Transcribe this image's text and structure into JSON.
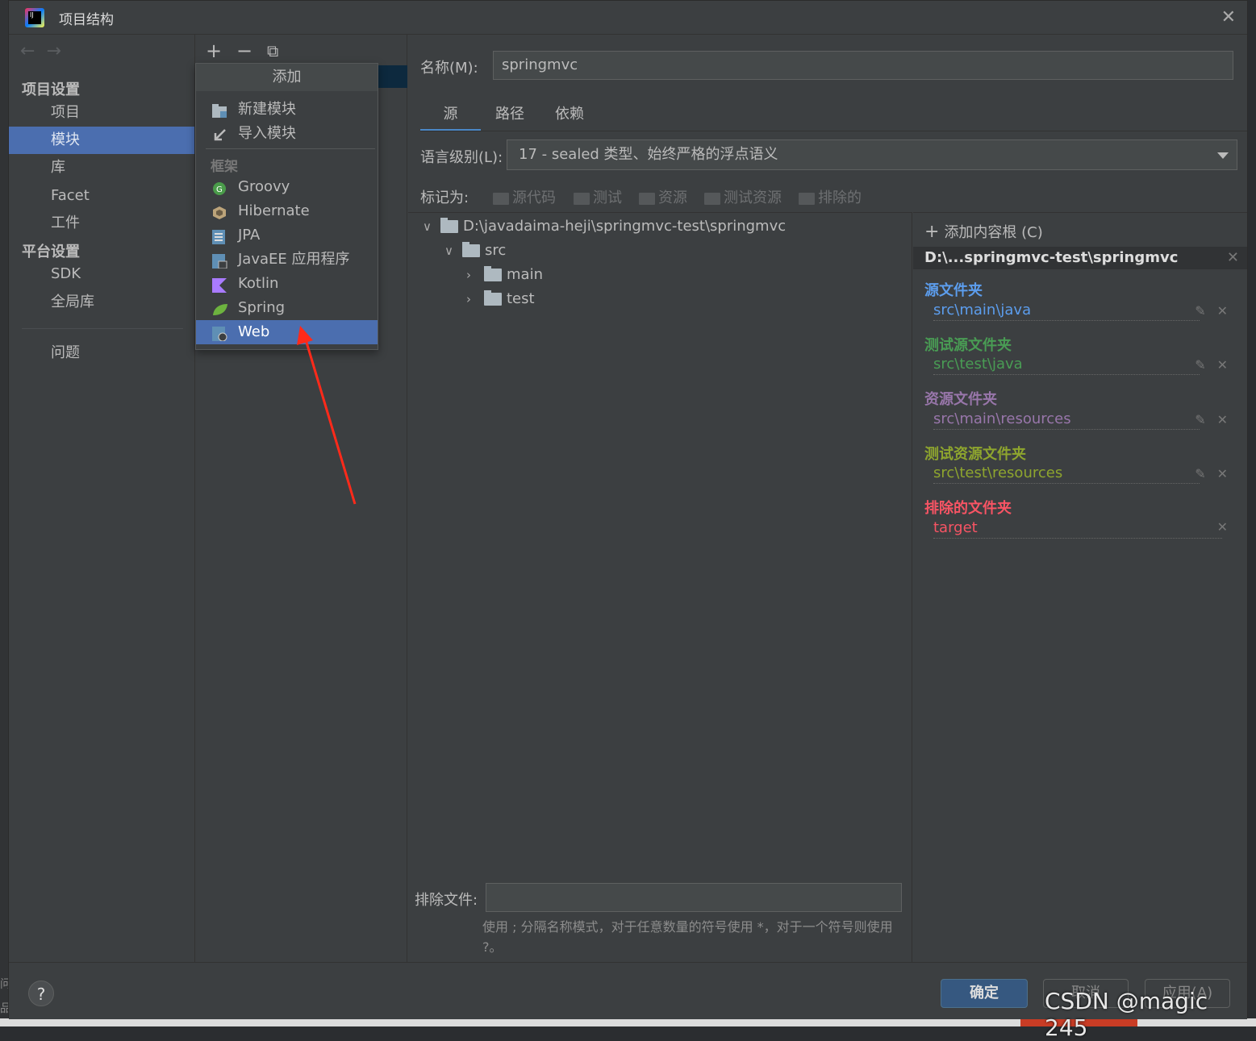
{
  "window": {
    "title": "项目结构"
  },
  "sidebar": {
    "project_settings_header": "项目设置",
    "platform_settings_header": "平台设置",
    "items": [
      {
        "label": "项目"
      },
      {
        "label": "模块"
      },
      {
        "label": "库"
      },
      {
        "label": "Facet"
      },
      {
        "label": "工件"
      },
      {
        "label": "SDK"
      },
      {
        "label": "全局库"
      },
      {
        "label": "问题"
      }
    ]
  },
  "module_toolbar": {
    "add": "+",
    "remove": "−",
    "copy": "⧉"
  },
  "add_popup": {
    "title": "添加",
    "items": [
      {
        "label": "新建模块",
        "icon": "folder-module-icon"
      },
      {
        "label": "导入模块",
        "icon": "import-arrow-icon"
      }
    ],
    "framework_header": "框架",
    "frameworks": [
      {
        "label": "Groovy",
        "icon": "groovy-icon",
        "color": "#4a9c4a"
      },
      {
        "label": "Hibernate",
        "icon": "hibernate-icon",
        "color": "#bca47a"
      },
      {
        "label": "JPA",
        "icon": "jpa-icon",
        "color": "#5f8fb5"
      },
      {
        "label": "JavaEE 应用程序",
        "icon": "javaee-icon",
        "color": "#5f8fb5"
      },
      {
        "label": "Kotlin",
        "icon": "kotlin-icon",
        "color": "#a97bff"
      },
      {
        "label": "Spring",
        "icon": "spring-leaf-icon",
        "color": "#6db33f"
      },
      {
        "label": "Web",
        "icon": "web-icon",
        "color": "#5f8fb5"
      }
    ],
    "selected": "Web"
  },
  "main": {
    "name_label": "名称(M):",
    "name_value": "springmvc",
    "tabs": [
      {
        "label": "源"
      },
      {
        "label": "路径"
      },
      {
        "label": "依赖"
      }
    ],
    "active_tab": "源",
    "lang_label": "语言级别(L):",
    "lang_value": "17 - sealed 类型、始终严格的浮点语义",
    "mark_label": "标记为:",
    "marks": [
      "源代码",
      "测试",
      "资源",
      "测试资源",
      "排除的"
    ],
    "tree": {
      "root": "D:\\javadaima-heji\\springmvc-test\\springmvc",
      "src": "src",
      "main": "main",
      "test": "test"
    },
    "exclude_label": "排除文件:",
    "exclude_hint": "使用 ; 分隔名称模式，对于任意数量的符号使用 *，对于一个符号则使用 ?。"
  },
  "content_root": {
    "add_label": "添加内容根 (C)",
    "path": "D:\\...springmvc-test\\springmvc",
    "groups": [
      {
        "title": "源文件夹",
        "path": "src\\main\\java",
        "color": "#5c9ded"
      },
      {
        "title": "测试源文件夹",
        "path": "src\\test\\java",
        "color": "#499c54"
      },
      {
        "title": "资源文件夹",
        "path": "src\\main\\resources",
        "color": "#9876aa"
      },
      {
        "title": "测试资源文件夹",
        "path": "src\\test\\resources",
        "color": "#8ea52e"
      },
      {
        "title": "排除的文件夹",
        "path": "target",
        "color": "#f75464"
      }
    ]
  },
  "footer": {
    "help": "?",
    "ok": "确定",
    "cancel": "取消",
    "apply": "应用(A)"
  },
  "watermark": "CSDN @magic 245"
}
